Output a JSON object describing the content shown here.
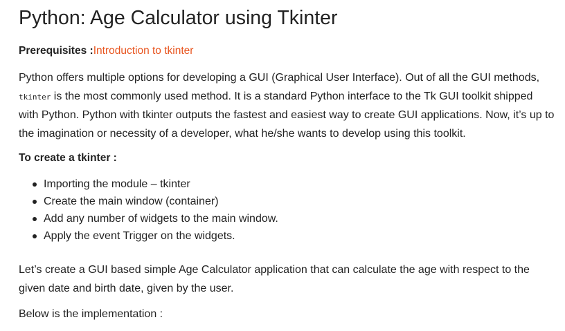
{
  "article": {
    "title": "Python: Age Calculator using Tkinter",
    "prerequisites": {
      "label": "Prerequisites :",
      "link_text": "Introduction to tkinter"
    },
    "intro": {
      "part1": "Python offers multiple options for developing a GUI (Graphical User Interface). Out of all the GUI methods, ",
      "code": "tkinter",
      "part2": " is the most commonly used method. It is a standard Python interface to the Tk GUI toolkit shipped with Python. Python with tkinter outputs the fastest and easiest way to create GUI applications. Now, it’s up to the imagination or necessity of a developer, what he/she wants to develop using this toolkit."
    },
    "steps_heading": "To create a tkinter :",
    "steps": [
      "Importing the module – tkinter",
      "Create the main window (container)",
      "Add any number of widgets to the main window.",
      "Apply the event Trigger on the widgets."
    ],
    "description": "Let’s create a GUI based simple Age Calculator application that can calculate the age with respect to the given date and birth date, given by the user.",
    "implementation_note": "Below is the implementation :"
  },
  "colors": {
    "text": "#222222",
    "link": "#e8541e",
    "background": "#ffffff"
  }
}
